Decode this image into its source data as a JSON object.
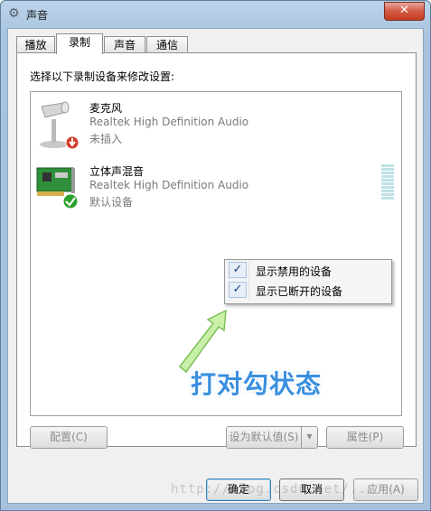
{
  "window": {
    "title": "声音",
    "close_label": "✕"
  },
  "tabs": [
    {
      "label": "播放"
    },
    {
      "label": "录制",
      "active": true
    },
    {
      "label": "声音"
    },
    {
      "label": "通信"
    }
  ],
  "panel": {
    "instruction": "选择以下录制设备来修改设置:"
  },
  "devices": [
    {
      "name": "麦克风",
      "description": "Realtek High Definition Audio",
      "status": "未插入",
      "icon": "microphone-icon",
      "badge": "unplugged-badge-icon"
    },
    {
      "name": "立体声混音",
      "description": "Realtek High Definition Audio",
      "status": "默认设备",
      "icon": "sound-card-icon",
      "badge": "default-check-badge-icon"
    }
  ],
  "context_menu": {
    "items": [
      {
        "label": "显示禁用的设备",
        "checked": true
      },
      {
        "label": "显示已断开的设备",
        "checked": true
      }
    ]
  },
  "annotation": {
    "callout_text": "打对勾状态"
  },
  "buttons": {
    "configure": "配置(C)",
    "set_default": "设为默认值(S)",
    "properties": "属性(P)",
    "ok": "确定",
    "cancel": "取消",
    "apply": "应用(A)"
  },
  "watermark": "http://blog.csdn.net/..."
}
